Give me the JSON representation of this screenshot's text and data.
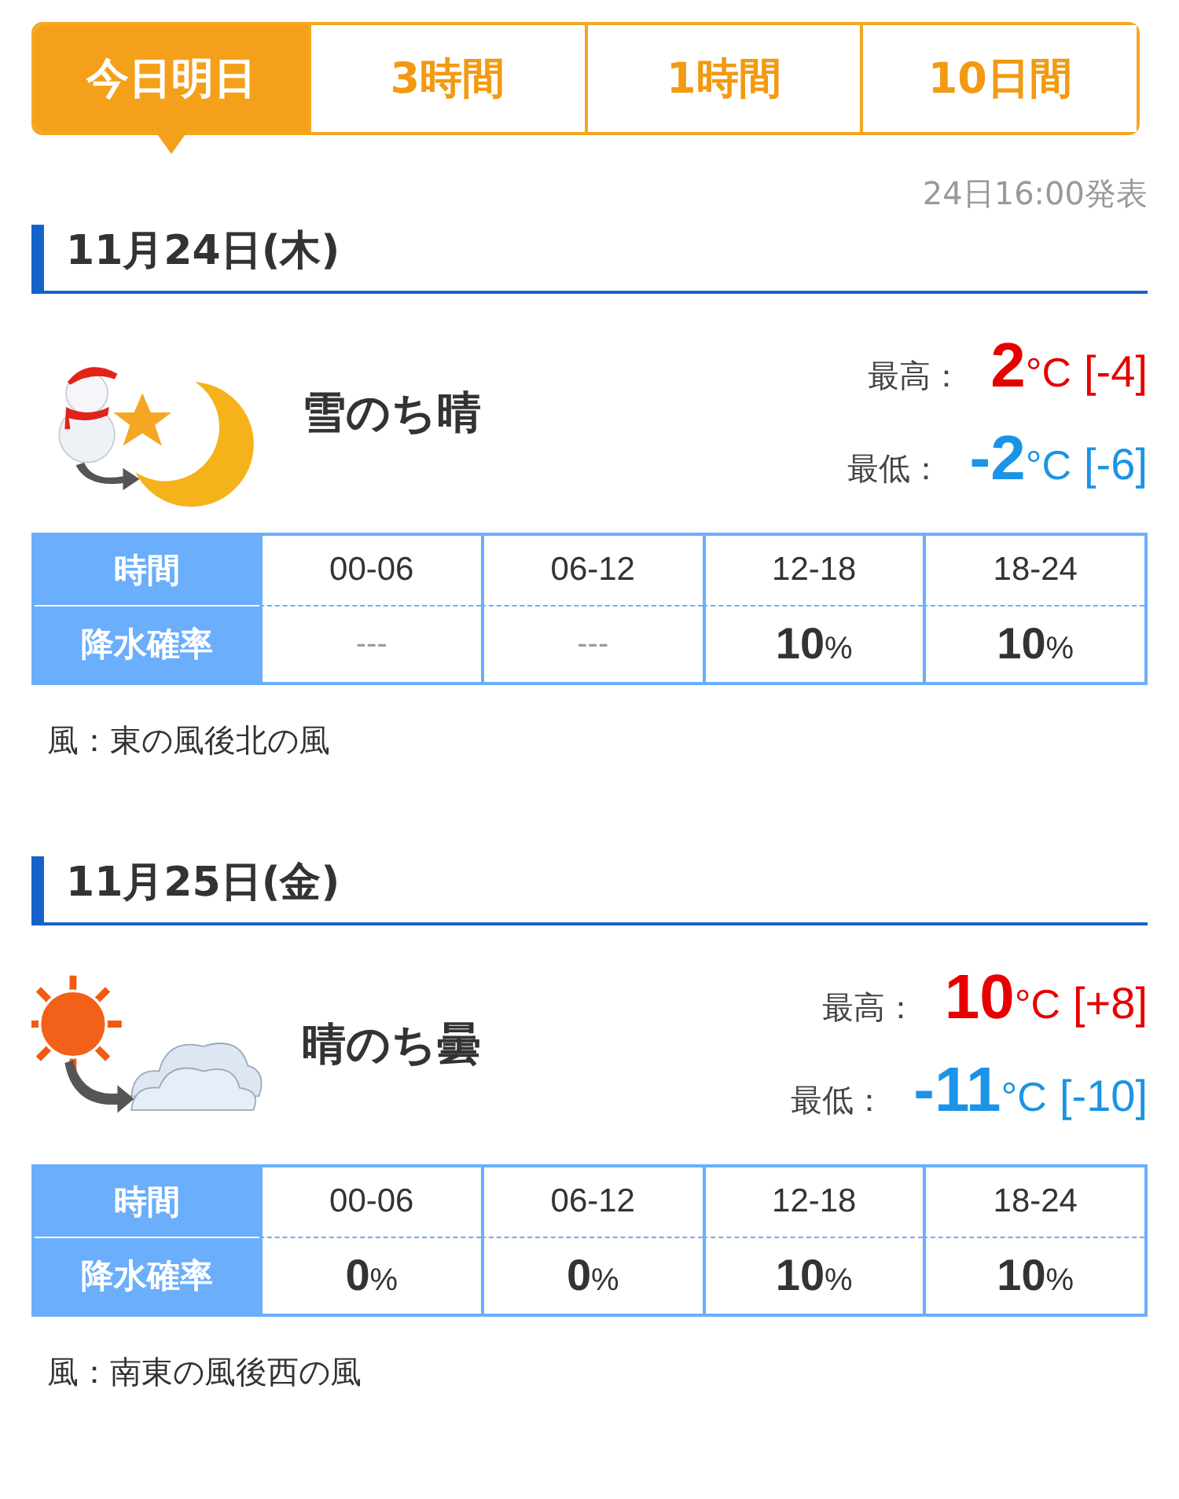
{
  "tabs": [
    {
      "label": "今日明日",
      "selected": true
    },
    {
      "label": "3時間",
      "selected": false
    },
    {
      "label": "1時間",
      "selected": false
    },
    {
      "label": "10日間",
      "selected": false
    }
  ],
  "published": "24日16:00発表",
  "days": [
    {
      "date": "11月24日(木)",
      "kind": "snow-then-moon",
      "weather": "雪のち晴",
      "high": {
        "label": "最高：",
        "value": "2",
        "unit": "°C",
        "diff": "[-4]"
      },
      "low": {
        "label": "最低：",
        "value": "-2",
        "unit": "°C",
        "diff": "[-6]"
      },
      "table": {
        "time_label": "時間",
        "rain_label": "降水確率",
        "times": [
          "00-06",
          "06-12",
          "12-18",
          "18-24"
        ],
        "rain": [
          {
            "value": "---"
          },
          {
            "value": "---"
          },
          {
            "value": "10",
            "unit": "%"
          },
          {
            "value": "10",
            "unit": "%"
          }
        ]
      },
      "wind": "風：東の風後北の風"
    },
    {
      "date": "11月25日(金)",
      "kind": "sun-then-cloud",
      "weather": "晴のち曇",
      "high": {
        "label": "最高：",
        "value": "10",
        "unit": "°C",
        "diff": "[+8]"
      },
      "low": {
        "label": "最低：",
        "value": "-11",
        "unit": "°C",
        "diff": "[-10]"
      },
      "table": {
        "time_label": "時間",
        "rain_label": "降水確率",
        "times": [
          "00-06",
          "06-12",
          "12-18",
          "18-24"
        ],
        "rain": [
          {
            "value": "0",
            "unit": "%"
          },
          {
            "value": "0",
            "unit": "%"
          },
          {
            "value": "10",
            "unit": "%"
          },
          {
            "value": "10",
            "unit": "%"
          }
        ]
      },
      "wind": "風：南東の風後西の風"
    }
  ]
}
